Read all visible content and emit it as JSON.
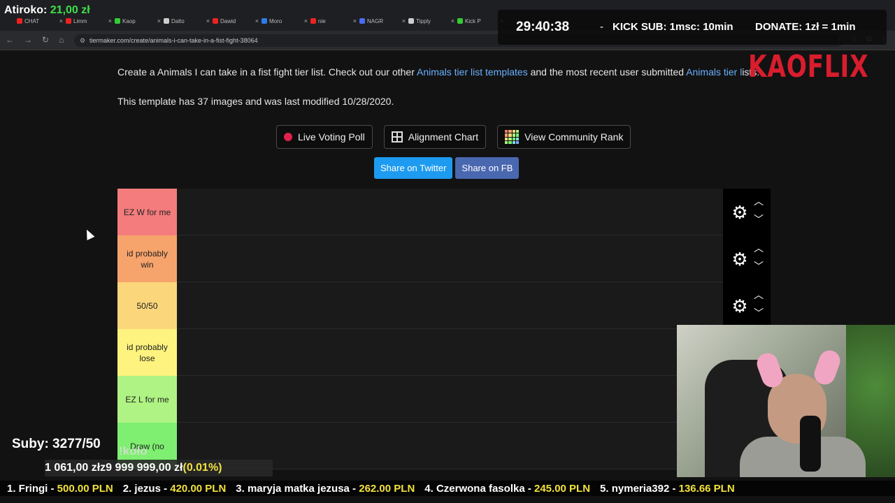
{
  "browser": {
    "tabs": [
      {
        "label": "CHAT",
        "color": "#e22"
      },
      {
        "label": "Limm",
        "color": "#e22"
      },
      {
        "label": "Kaop",
        "color": "#3c3"
      },
      {
        "label": "Dalto",
        "color": "#ccc"
      },
      {
        "label": "Dawid",
        "color": "#e22"
      },
      {
        "label": "Moro",
        "color": "#2b7de9"
      },
      {
        "label": "nie",
        "color": "#e22"
      },
      {
        "label": "NAGR",
        "color": "#4a6cf0"
      },
      {
        "label": "Tipply",
        "color": "#ccc"
      },
      {
        "label": "Kick P",
        "color": "#3c3"
      }
    ],
    "url": "tiermaker.com/create/animals-i-can-take-in-a-fist-fight-38064"
  },
  "page": {
    "intro_prefix": "Create a Animals I can take in a fist fight tier list. Check out our other ",
    "intro_link1": "Animals tier list templates",
    "intro_middle": " and the most recent user submitted ",
    "intro_link2": "Animals tier l",
    "intro_suffix": "ists.",
    "meta": "This template has 37 images and was last modified 10/28/2020.",
    "buttons": {
      "live_voting": "Live Voting Poll",
      "alignment": "Alignment Chart",
      "community": "View Community Rank",
      "share_twitter": "Share on Twitter",
      "share_fb": "Share on FB"
    },
    "tiers": [
      {
        "label": "EZ W for me",
        "color": "#f47c7c"
      },
      {
        "label": "id probably win",
        "color": "#f7a46c"
      },
      {
        "label": "50/50",
        "color": "#fbd67b"
      },
      {
        "label": "id probably lose",
        "color": "#fdf37e"
      },
      {
        "label": "EZ L for me",
        "color": "#aef383"
      },
      {
        "label": "Draw (no",
        "color": "#7eef70"
      }
    ]
  },
  "overlay": {
    "donate_prefix": "Atiroko: ",
    "donate_amount": "21,00 zł",
    "timer": "29:40:38",
    "dash": "-",
    "kick_sub": "KICK SUB: 1msc: 10min",
    "donate_rate": "DONATE: 1zł = 1min",
    "logo": "KAOFLIX",
    "subs": "Suby: 3277/50",
    "kolo": "!koło",
    "goal_current": "1 061,00 zł",
    "goal_sep": " z ",
    "goal_target": "9 999 999,00 zł",
    "goal_pct": "(0.01%)",
    "ticker": [
      {
        "rank": "1. Fringi - ",
        "amount": "500.00 PLN"
      },
      {
        "rank": "2. jezus - ",
        "amount": "420.00 PLN"
      },
      {
        "rank": "3. maryja matka jezusa - ",
        "amount": "262.00 PLN"
      },
      {
        "rank": "4. Czerwona fasolka - ",
        "amount": "245.00 PLN"
      },
      {
        "rank": "5. nymeria392 - ",
        "amount": "136.66 PLN"
      }
    ]
  }
}
